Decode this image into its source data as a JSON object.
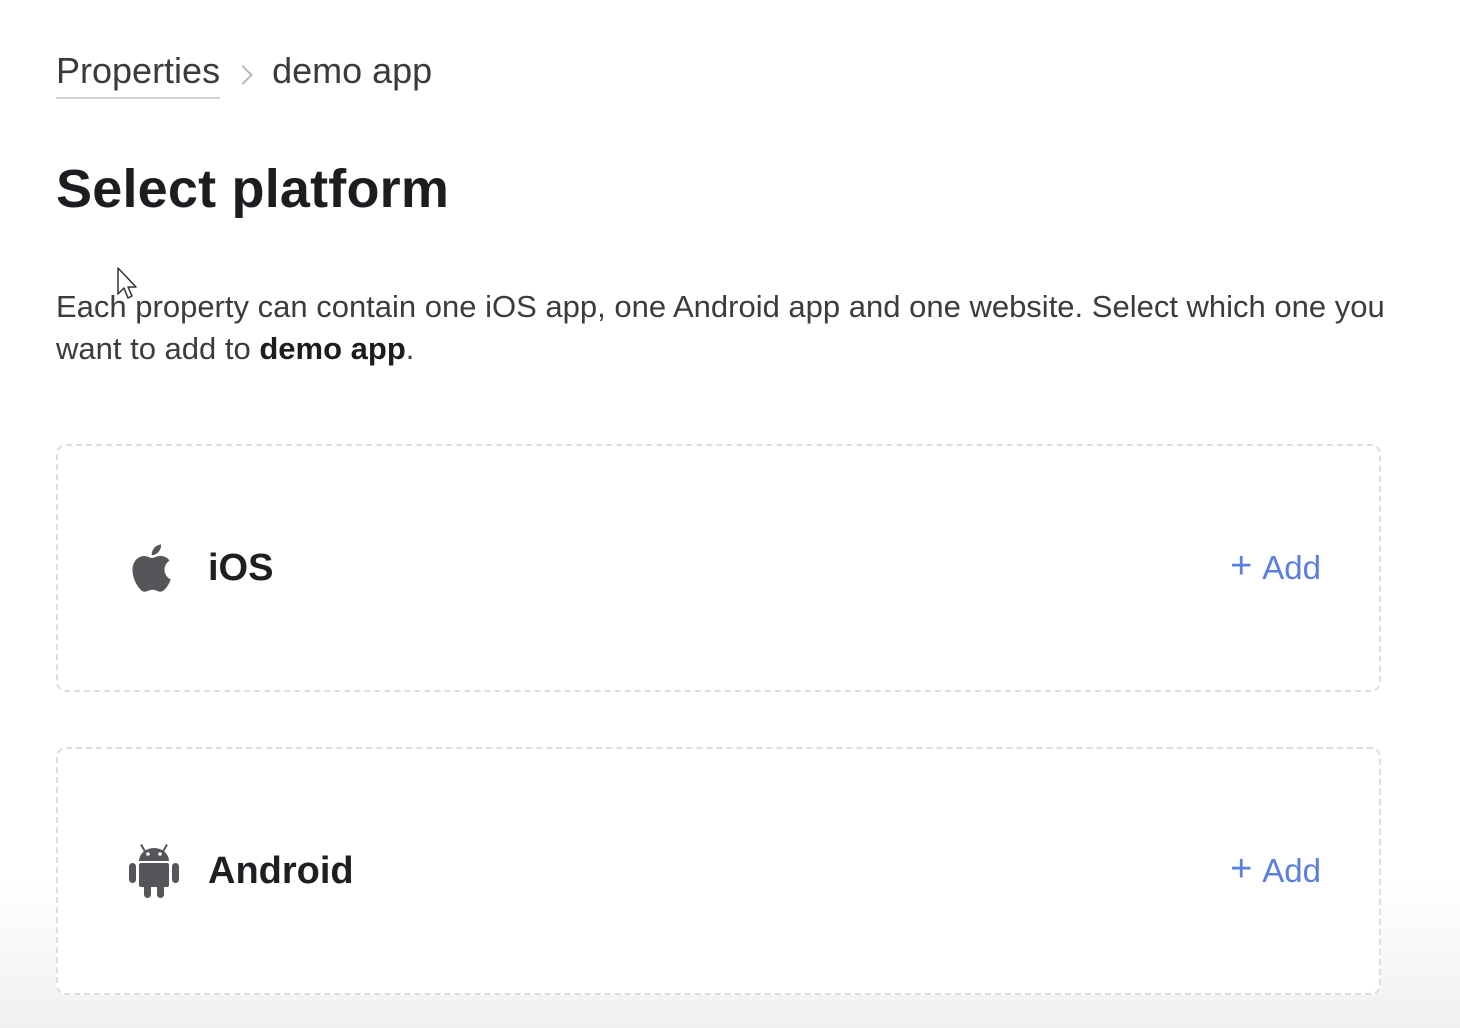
{
  "breadcrumb": {
    "parent": "Properties",
    "current": "demo app"
  },
  "page": {
    "title": "Select platform",
    "description_prefix": "Each property can contain one iOS app, one Android app and one website. Select which one you want to add to ",
    "description_app": "demo app",
    "description_suffix": "."
  },
  "platforms": [
    {
      "name": "iOS",
      "icon": "apple-icon",
      "action_label": "Add"
    },
    {
      "name": "Android",
      "icon": "android-icon",
      "action_label": "Add"
    }
  ],
  "colors": {
    "accent": "#5b7fe0",
    "icon_gray": "#55565a",
    "card_border": "#dcdde0"
  }
}
